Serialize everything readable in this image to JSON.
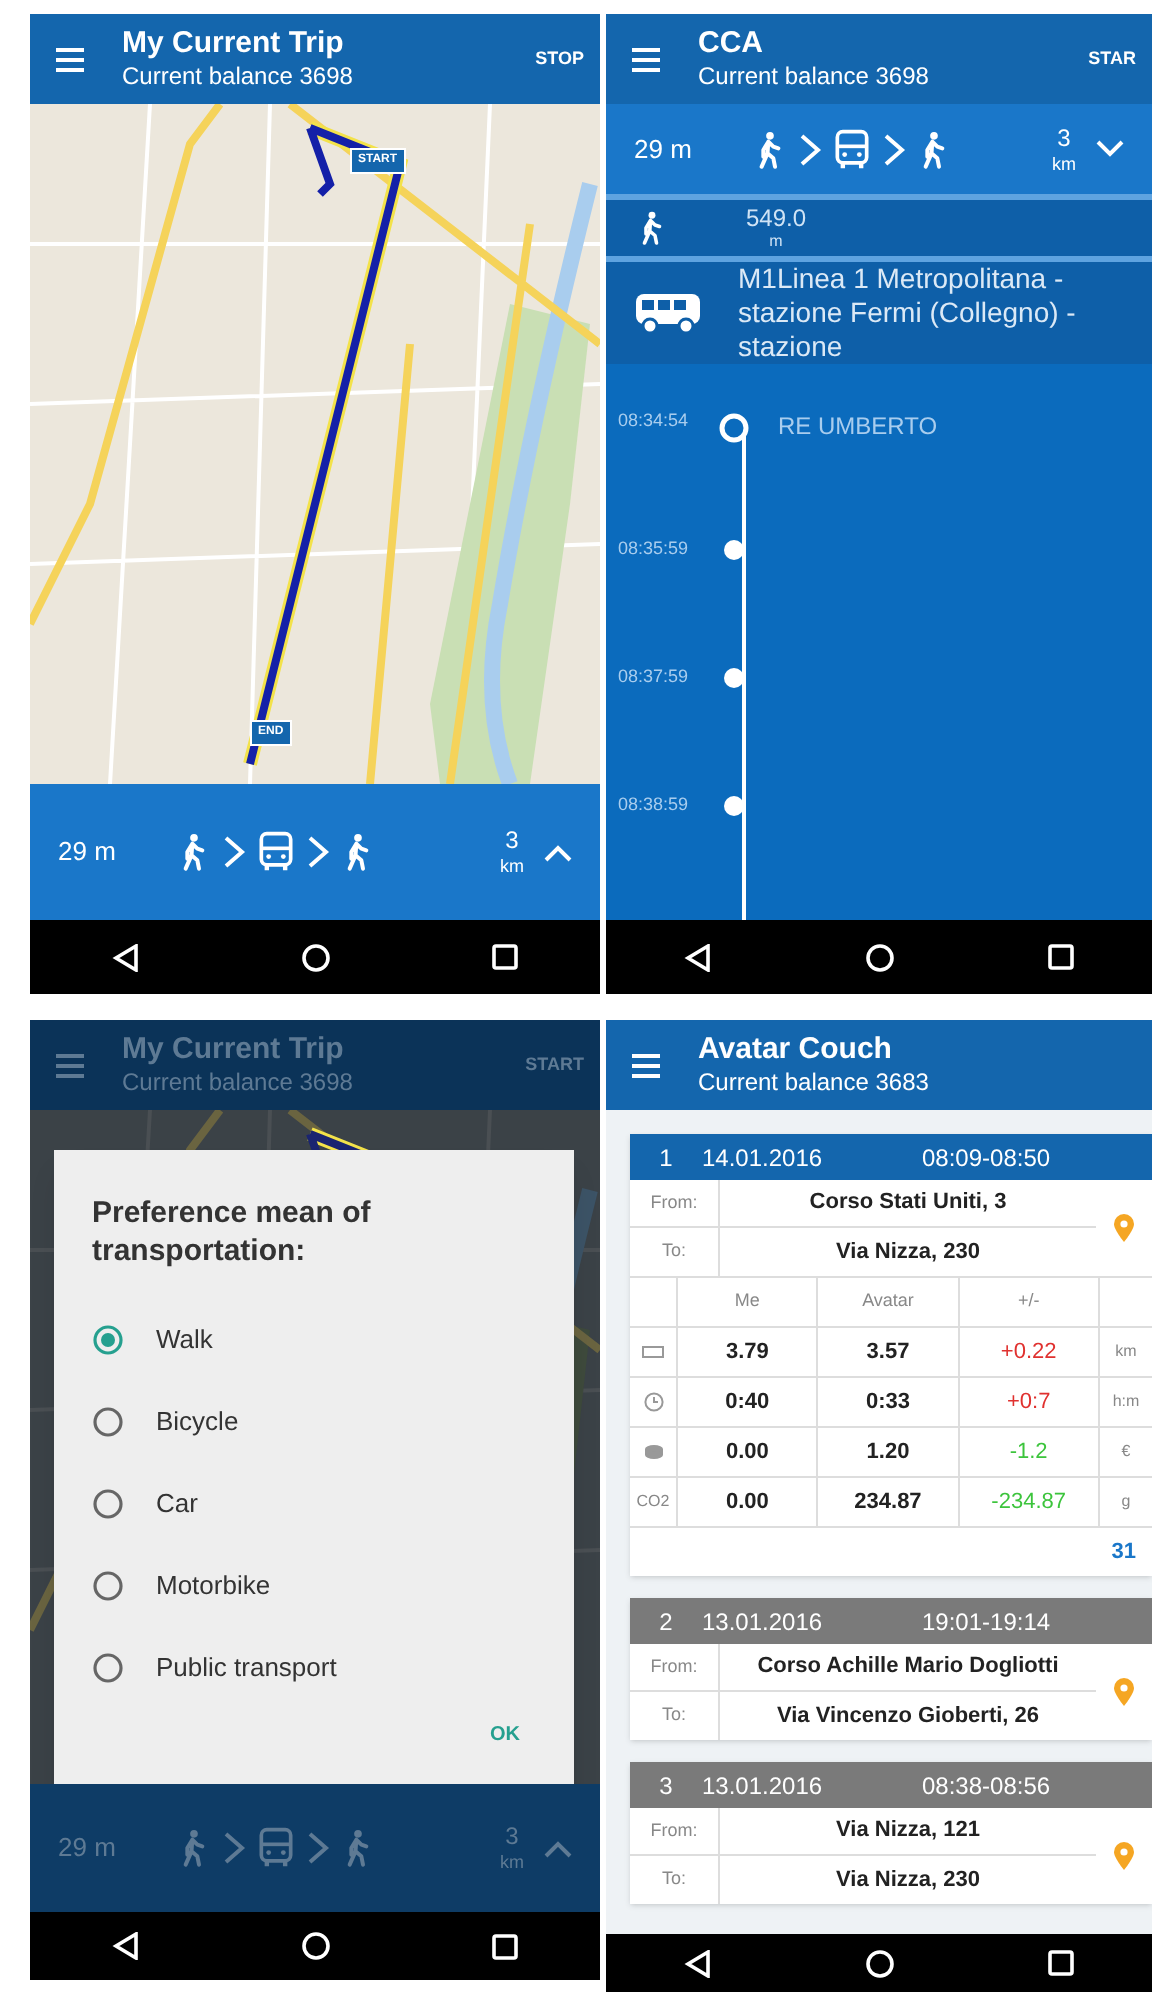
{
  "screens": [
    {
      "kind": "map",
      "header": {
        "title": "My Current Trip",
        "subtitle": "Current balance 3698",
        "action": "STOP"
      },
      "markers": [
        {
          "label": "START"
        },
        {
          "label": "END"
        }
      ],
      "summary": {
        "duration": "29 m",
        "modes": [
          {
            "kind": "walk"
          },
          {
            "kind": "bus"
          },
          {
            "kind": "walk"
          }
        ],
        "distance": "3",
        "unit": "km",
        "expanded": false
      }
    },
    {
      "kind": "route",
      "header": {
        "title": "CCA",
        "subtitle": "Current balance 3698",
        "action": "STAR"
      },
      "summary": {
        "duration": "29 m",
        "modes": [
          {
            "kind": "walk"
          },
          {
            "kind": "bus"
          },
          {
            "kind": "walk"
          }
        ],
        "distance": "3",
        "unit": "km",
        "expanded": true
      },
      "legs": [
        {
          "kind": "walk",
          "distance": "549.0",
          "unit": "m"
        },
        {
          "kind": "bus",
          "line": "M1Linea 1 Metropolitana - stazione Fermi (Collegno) - stazione"
        }
      ],
      "stops": [
        {
          "kind": "origin",
          "time": "08:34:54",
          "name": "RE UMBERTO"
        },
        {
          "kind": "stop",
          "time": "08:35:59"
        },
        {
          "kind": "stop",
          "time": "08:37:59"
        },
        {
          "kind": "stop",
          "time": "08:38:59"
        }
      ]
    },
    {
      "kind": "dialog",
      "header": {
        "title": "My Current Trip",
        "subtitle": "Current balance 3698",
        "action": "START"
      },
      "summary": {
        "duration": "29 m",
        "modes": [
          {
            "kind": "walk"
          },
          {
            "kind": "bus"
          },
          {
            "kind": "walk"
          }
        ],
        "distance": "3",
        "unit": "km",
        "expanded": false
      },
      "dialog": {
        "title": "Preference mean of transportation:",
        "options": [
          {
            "label": "Walk",
            "selected": true
          },
          {
            "label": "Bicycle",
            "selected": false
          },
          {
            "label": "Car",
            "selected": false
          },
          {
            "label": "Motorbike",
            "selected": false
          },
          {
            "label": "Public transport",
            "selected": false
          }
        ],
        "button": "OK"
      }
    },
    {
      "kind": "trips",
      "header": {
        "title": "Avatar Couch",
        "subtitle": "Current balance 3683"
      },
      "trips": [
        {
          "number": "1",
          "date": "14.01.2016",
          "time": "08:09-08:50",
          "selected": true,
          "from_label": "From:",
          "from": "Corso Stati Uniti, 3",
          "to_label": "To:",
          "to": "Via Nizza, 230",
          "stats": {
            "columns": [
              "Me",
              "Avatar",
              "+/-"
            ],
            "rows": [
              {
                "kind": "distance",
                "me": "3.79",
                "avatar": "3.57",
                "diff": "+0.22",
                "color": "#e0312f",
                "unit": "km"
              },
              {
                "kind": "time",
                "me": "0:40",
                "avatar": "0:33",
                "diff": "+0:7",
                "color": "#e0312f",
                "unit": "h:m"
              },
              {
                "kind": "money",
                "me": "0.00",
                "avatar": "1.20",
                "diff": "-1.2",
                "color": "#3cc43c",
                "unit": "€"
              },
              {
                "kind": "co2",
                "label": "CO2",
                "me": "0.00",
                "avatar": "234.87",
                "diff": "-234.87",
                "color": "#3cc43c",
                "unit": "g"
              }
            ],
            "score": "31"
          }
        },
        {
          "number": "2",
          "date": "13.01.2016",
          "time": "19:01-19:14",
          "selected": false,
          "from_label": "From:",
          "from": "Corso Achille Mario Dogliotti",
          "to_label": "To:",
          "to": "Via Vincenzo Gioberti, 26"
        },
        {
          "number": "3",
          "date": "13.01.2016",
          "time": "08:38-08:56",
          "selected": false,
          "from_label": "From:",
          "from": "Via Nizza, 121",
          "to_label": "To:",
          "to": "Via Nizza, 230"
        }
      ]
    }
  ]
}
